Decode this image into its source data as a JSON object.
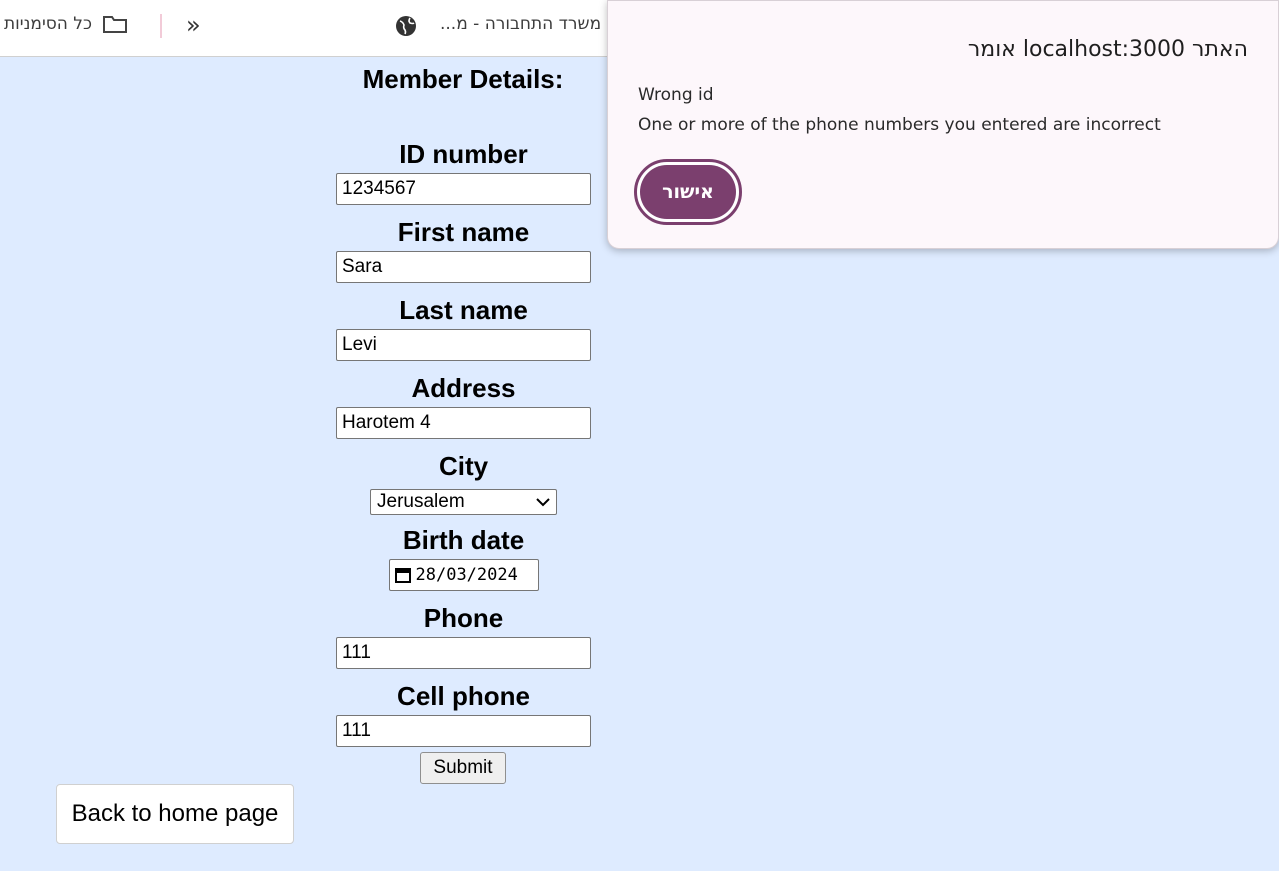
{
  "bookmarks_bar": {
    "all_bookmarks_label": "כל הסימניות",
    "overflow_chevron": "»",
    "site_bookmark_label": "משרד התחבורה - מ..."
  },
  "form": {
    "title": "Member Details:",
    "fields": {
      "id_number": {
        "label": "ID number",
        "value": "1234567"
      },
      "first_name": {
        "label": "First name",
        "value": "Sara"
      },
      "last_name": {
        "label": "Last name",
        "value": "Levi"
      },
      "address": {
        "label": "Address",
        "value": "Harotem 4"
      },
      "city": {
        "label": "City",
        "value": "Jerusalem"
      },
      "birth_date": {
        "label": "Birth date",
        "value": "28/03/2024"
      },
      "phone": {
        "label": "Phone",
        "value": "111"
      },
      "cell_phone": {
        "label": "Cell phone",
        "value": "111"
      }
    },
    "submit_label": "Submit",
    "home_label": "Back to home page"
  },
  "dialog": {
    "title": "האתר localhost:3000 אומר",
    "message_line1": "Wrong id",
    "message_line2": "One or more of the phone numbers you entered are incorrect",
    "ok_label": "אישור",
    "accent_color": "#7b3f6e"
  },
  "colors": {
    "page_background": "#deebff"
  }
}
